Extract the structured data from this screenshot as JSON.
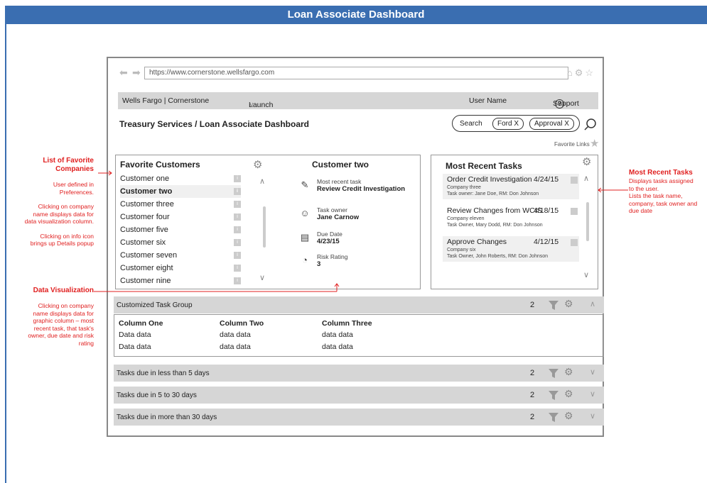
{
  "banner": {
    "title": "Loan Associate Dashboard"
  },
  "browser": {
    "url": "https://www.cornerstone.wellsfargo.com"
  },
  "topbar": {
    "brand": "Wells Fargo | Cornerstone",
    "launch": "Launch",
    "user": "User Name",
    "support": "Support",
    "help": "?"
  },
  "header": {
    "title": "Treasury Services / Loan Associate Dashboard",
    "search_label": "Search",
    "chips": [
      "Ford X",
      "Approval X"
    ],
    "favorite_links": "Favorite Links"
  },
  "favorites": {
    "title": "Favorite Customers",
    "items": [
      "Customer one",
      "Customer two",
      "Customer three",
      "Customer four",
      "Customer five",
      "Customer six",
      "Customer seven",
      "Customer eight",
      "Customer nine"
    ],
    "info": "i"
  },
  "viz": {
    "title": "Customer two",
    "rows": [
      {
        "label": "Most recent task",
        "value": "Review Credit Investigation"
      },
      {
        "label": "Task owner",
        "value": "Jane Carnow"
      },
      {
        "label": "Due Date",
        "value": "4/23/15"
      },
      {
        "label": "Risk Rating",
        "value": "3"
      }
    ]
  },
  "recent": {
    "title": "Most Recent Tasks",
    "items": [
      {
        "name": "Order Credit Investigation",
        "date": "4/24/15",
        "company": "Company three",
        "owner": "Task owner: Jane Doe, RM: Don Johnson"
      },
      {
        "name": "Review Changes from WCIS",
        "date": "4/18/15",
        "company": "Company eleven",
        "owner": "Task Owner, Mary Dodd, RM: Don Johnson"
      },
      {
        "name": "Approve Changes",
        "date": "4/12/15",
        "company": "Company six",
        "owner": "Task Owner, John Roberts, RM: Don Johnson"
      }
    ]
  },
  "groups": [
    {
      "name": "Customized Task Group",
      "count": "2",
      "chevron": "^"
    },
    {
      "name": "Tasks due in less than 5 days",
      "count": "2",
      "chevron": "v"
    },
    {
      "name": "Tasks due in 5 to 30 days",
      "count": "2",
      "chevron": "v"
    },
    {
      "name": "Tasks due in more than 30 days",
      "count": "2",
      "chevron": "v"
    }
  ],
  "group_table": {
    "columns": [
      "Column One",
      "Column Two",
      "Column Three"
    ],
    "rows": [
      [
        "Data data",
        "data data",
        "data data"
      ],
      [
        "Data data",
        "data data",
        "data data"
      ]
    ]
  },
  "annotations": {
    "fav": {
      "title": "List of Favorite Companies",
      "lines": [
        "User defined in Preferences.",
        "Clicking on company name displays data for data visualization column.",
        "Clicking on info icon brings up Details popup"
      ]
    },
    "viz": {
      "title": "Data Visualization",
      "lines": [
        "Clicking on company name displays data for graphic column – most recent task, that task's owner, due date and risk rating"
      ]
    },
    "recent": {
      "title": "Most Recent Tasks",
      "lines": [
        "Displays tasks assigned to the user.",
        "Lists the task name, company, task owner and due date"
      ]
    }
  },
  "colors": {
    "banner": "#3a6eb1",
    "annotation": "#e02020",
    "bar": "#d6d6d6"
  },
  "icons": [
    "back-arrow-icon",
    "forward-arrow-icon",
    "home-icon",
    "gear-icon",
    "star-icon",
    "help-icon",
    "search-icon",
    "edit-icon",
    "person-icon",
    "calendar-icon",
    "gauge-icon",
    "filter-icon",
    "chevron-up-icon",
    "chevron-down-icon",
    "info-icon"
  ]
}
